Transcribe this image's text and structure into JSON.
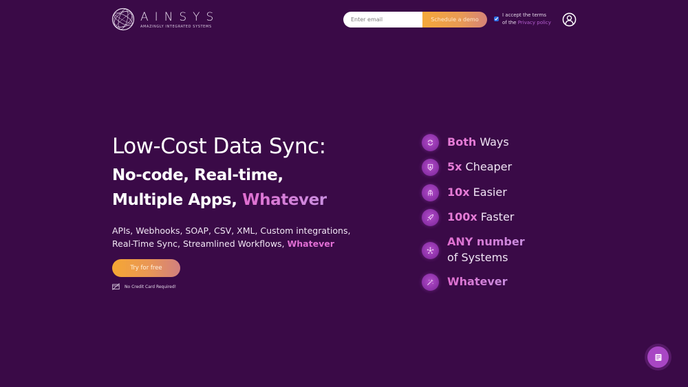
{
  "header": {
    "logo": {
      "name": "AINSYS",
      "tagline": "AMAZINGLY INTEGRATED SYSTEMS",
      "icon": "globe-lines-icon"
    },
    "email_placeholder": "Enter email",
    "email_value": "",
    "demo_button_label": "Schedule a demo",
    "terms": {
      "checked": true,
      "text_line1": "I accept the terms",
      "text_prefix": "of the ",
      "link_label": "Privacy policy"
    },
    "account_icon": "user-circle-icon"
  },
  "hero": {
    "title": "Low-Cost Data Sync:",
    "subtitle_line1": "No-code, Real-time,",
    "subtitle_line2_prefix": "Multiple Apps, ",
    "subtitle_line2_highlight": "Whatever",
    "description_line1": "APIs, Webhooks, SOAP, CSV, XML, Custom integrations,",
    "description_line2_prefix": "Real-Time Sync, Streamlined Workflows, ",
    "description_line2_highlight": "Whatever",
    "cta_label": "Try for free",
    "note": "No Credit Card Required!",
    "note_icon": "no-card-icon"
  },
  "features": [
    {
      "icon": "sync-arrows-icon",
      "strong": "Both",
      "rest": " Ways"
    },
    {
      "icon": "price-tag-down-icon",
      "strong": "5x",
      "rest": " Cheaper"
    },
    {
      "icon": "hands-icon",
      "strong": "10x",
      "rest": " Easier"
    },
    {
      "icon": "rocket-icon",
      "strong": "100x",
      "rest": " Faster"
    },
    {
      "icon": "network-nodes-icon",
      "strong": "ANY number",
      "rest_line2": "of Systems"
    },
    {
      "icon": "magic-wand-icon",
      "strong": "Whatever",
      "rest": ""
    }
  ],
  "chat": {
    "icon": "chat-document-icon"
  },
  "colors": {
    "background": "#3a0a47",
    "accent_pink": "#e06ed4",
    "accent_purple": "#a846c4",
    "cta_orange": "#f5a733",
    "link": "#b45fd1"
  }
}
